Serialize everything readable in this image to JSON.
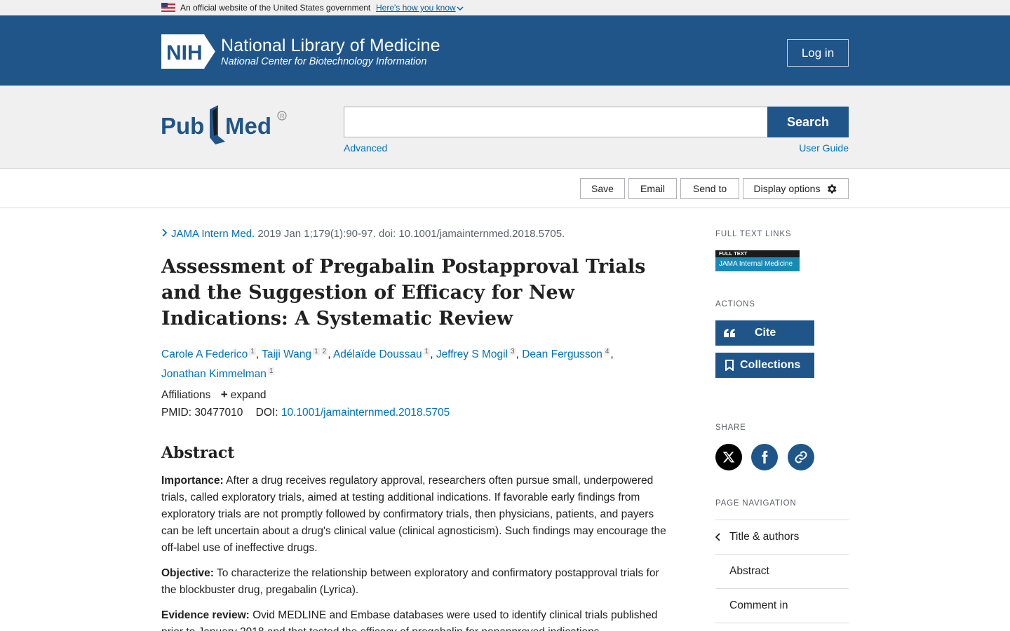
{
  "gov_banner": {
    "text": "An official website of the United States government",
    "link": "Here's how you know"
  },
  "nih": {
    "logo_text": "NIH",
    "title": "National Library of Medicine",
    "subtitle": "National Center for Biotechnology Information",
    "login": "Log in"
  },
  "search": {
    "logo_pub": "Pub",
    "logo_med": "Med",
    "button": "Search",
    "value": "",
    "advanced": "Advanced",
    "user_guide": "User Guide"
  },
  "toolbar": {
    "save": "Save",
    "email": "Email",
    "send_to": "Send to",
    "display_options": "Display options"
  },
  "article": {
    "journal": "JAMA Intern Med.",
    "citation": "2019 Jan 1;179(1):90-97. doi: 10.1001/jamainternmed.2018.5705.",
    "title": "Assessment of Pregabalin Postapproval Trials and the Suggestion of Efficacy for New Indications: A Systematic Review",
    "authors": [
      {
        "name": "Carole A Federico",
        "affils": [
          "1"
        ]
      },
      {
        "name": "Taiji Wang",
        "affils": [
          "1",
          "2"
        ]
      },
      {
        "name": "Adélaïde Doussau",
        "affils": [
          "1"
        ]
      },
      {
        "name": "Jeffrey S Mogil",
        "affils": [
          "3"
        ]
      },
      {
        "name": "Dean Fergusson",
        "affils": [
          "4"
        ]
      },
      {
        "name": "Jonathan Kimmelman",
        "affils": [
          "1"
        ]
      }
    ],
    "affiliations_label": "Affiliations",
    "expand_label": "expand",
    "pmid_label": "PMID:",
    "pmid": "30477010",
    "doi_label": "DOI:",
    "doi": "10.1001/jamainternmed.2018.5705"
  },
  "abstract": {
    "heading": "Abstract",
    "importance_label": "Importance:",
    "importance_text": "After a drug receives regulatory approval, researchers often pursue small, underpowered trials, called exploratory trials, aimed at testing additional indications. If favorable early findings from exploratory trials are not promptly followed by confirmatory trials, then physicians, patients, and payers can be left uncertain about a drug's clinical value (clinical agnosticism). Such findings may encourage the off-label use of ineffective drugs.",
    "objective_label": "Objective:",
    "objective_text": "To characterize the relationship between exploratory and confirmatory postapproval trials for the blockbuster drug, pregabalin (Lyrica).",
    "evidence_label": "Evidence review:",
    "evidence_text": "Ovid MEDLINE and Embase databases were used to identify clinical trials published prior to January 2018 and that tested the efficacy of pregabalin for nonapproved indications."
  },
  "sidebar": {
    "full_text_links": "FULL TEXT LINKS",
    "badge_top": "FULL TEXT",
    "badge_bottom": "JAMA Internal Medicine",
    "actions": "ACTIONS",
    "cite": "Cite",
    "collections": "Collections",
    "share": "SHARE",
    "page_navigation": "PAGE NAVIGATION",
    "nav_items": [
      "Title & authors",
      "Abstract",
      "Comment in"
    ]
  },
  "colors": {
    "nih_blue": "#20558a",
    "link_blue": "#0071bc",
    "facebook": "#20558a",
    "x": "#000000"
  }
}
